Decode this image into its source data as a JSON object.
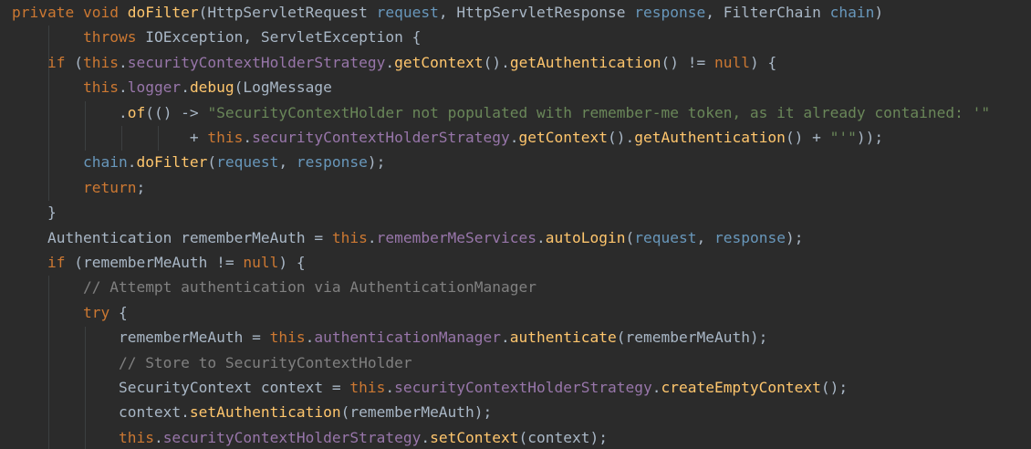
{
  "editor": {
    "language": "java",
    "colors": {
      "background": "#2b2b2b",
      "keyword": "#cc7832",
      "method": "#ffc66d",
      "field": "#9876aa",
      "parameter": "#6897bb",
      "string": "#6a8759",
      "comment": "#808080",
      "plain": "#a9b7c6"
    },
    "lines": [
      [
        {
          "t": "kw",
          "v": "private void "
        },
        {
          "t": "fn",
          "v": "doFilter"
        },
        {
          "t": "pl",
          "v": "(HttpServletRequest "
        },
        {
          "t": "prm",
          "v": "request"
        },
        {
          "t": "pl",
          "v": ", HttpServletResponse "
        },
        {
          "t": "prm",
          "v": "response"
        },
        {
          "t": "pl",
          "v": ", FilterChain "
        },
        {
          "t": "prm",
          "v": "chain"
        },
        {
          "t": "pl",
          "v": ")"
        }
      ],
      [
        {
          "t": "pl",
          "v": "        "
        },
        {
          "t": "kw",
          "v": "throws "
        },
        {
          "t": "pl",
          "v": "IOException, ServletException {"
        }
      ],
      [
        {
          "t": "pl",
          "v": "    "
        },
        {
          "t": "kw",
          "v": "if "
        },
        {
          "t": "pl",
          "v": "("
        },
        {
          "t": "kw",
          "v": "this"
        },
        {
          "t": "pl",
          "v": "."
        },
        {
          "t": "fld",
          "v": "securityContextHolderStrategy"
        },
        {
          "t": "pl",
          "v": "."
        },
        {
          "t": "fn",
          "v": "getContext"
        },
        {
          "t": "pl",
          "v": "()."
        },
        {
          "t": "fn",
          "v": "getAuthentication"
        },
        {
          "t": "pl",
          "v": "() != "
        },
        {
          "t": "kw",
          "v": "null"
        },
        {
          "t": "pl",
          "v": ") {"
        }
      ],
      [
        {
          "t": "pl",
          "v": "        "
        },
        {
          "t": "kw",
          "v": "this"
        },
        {
          "t": "pl",
          "v": "."
        },
        {
          "t": "fld",
          "v": "logger"
        },
        {
          "t": "pl",
          "v": "."
        },
        {
          "t": "fn",
          "v": "debug"
        },
        {
          "t": "pl",
          "v": "(LogMessage"
        }
      ],
      [
        {
          "t": "pl",
          "v": "            ."
        },
        {
          "t": "fn",
          "v": "of"
        },
        {
          "t": "pl",
          "v": "(() -> "
        },
        {
          "t": "str",
          "v": "\"SecurityContextHolder not populated with remember-me token, as it already contained: '\""
        }
      ],
      [
        {
          "t": "pl",
          "v": "                    + "
        },
        {
          "t": "kw",
          "v": "this"
        },
        {
          "t": "pl",
          "v": "."
        },
        {
          "t": "fld",
          "v": "securityContextHolderStrategy"
        },
        {
          "t": "pl",
          "v": "."
        },
        {
          "t": "fn",
          "v": "getContext"
        },
        {
          "t": "pl",
          "v": "()."
        },
        {
          "t": "fn",
          "v": "getAuthentication"
        },
        {
          "t": "pl",
          "v": "() + "
        },
        {
          "t": "str",
          "v": "\"'\""
        },
        {
          "t": "pl",
          "v": "));"
        }
      ],
      [
        {
          "t": "pl",
          "v": "        "
        },
        {
          "t": "prm",
          "v": "chain"
        },
        {
          "t": "pl",
          "v": "."
        },
        {
          "t": "fn",
          "v": "doFilter"
        },
        {
          "t": "pl",
          "v": "("
        },
        {
          "t": "prm",
          "v": "request"
        },
        {
          "t": "pl",
          "v": ", "
        },
        {
          "t": "prm",
          "v": "response"
        },
        {
          "t": "pl",
          "v": ");"
        }
      ],
      [
        {
          "t": "pl",
          "v": "        "
        },
        {
          "t": "kw",
          "v": "return"
        },
        {
          "t": "pl",
          "v": ";"
        }
      ],
      [
        {
          "t": "pl",
          "v": "    }"
        }
      ],
      [
        {
          "t": "pl",
          "v": "    Authentication rememberMeAuth = "
        },
        {
          "t": "kw",
          "v": "this"
        },
        {
          "t": "pl",
          "v": "."
        },
        {
          "t": "fld",
          "v": "rememberMeServices"
        },
        {
          "t": "pl",
          "v": "."
        },
        {
          "t": "fn",
          "v": "autoLogin"
        },
        {
          "t": "pl",
          "v": "("
        },
        {
          "t": "prm",
          "v": "request"
        },
        {
          "t": "pl",
          "v": ", "
        },
        {
          "t": "prm",
          "v": "response"
        },
        {
          "t": "pl",
          "v": ");"
        }
      ],
      [
        {
          "t": "pl",
          "v": "    "
        },
        {
          "t": "kw",
          "v": "if "
        },
        {
          "t": "pl",
          "v": "(rememberMeAuth != "
        },
        {
          "t": "kw",
          "v": "null"
        },
        {
          "t": "pl",
          "v": ") {"
        }
      ],
      [
        {
          "t": "pl",
          "v": "        "
        },
        {
          "t": "cmt",
          "v": "// Attempt authentication via AuthenticationManager"
        }
      ],
      [
        {
          "t": "pl",
          "v": "        "
        },
        {
          "t": "kw",
          "v": "try "
        },
        {
          "t": "pl",
          "v": "{"
        }
      ],
      [
        {
          "t": "pl",
          "v": "            rememberMeAuth = "
        },
        {
          "t": "kw",
          "v": "this"
        },
        {
          "t": "pl",
          "v": "."
        },
        {
          "t": "fld",
          "v": "authenticationManager"
        },
        {
          "t": "pl",
          "v": "."
        },
        {
          "t": "fn",
          "v": "authenticate"
        },
        {
          "t": "pl",
          "v": "(rememberMeAuth);"
        }
      ],
      [
        {
          "t": "pl",
          "v": "            "
        },
        {
          "t": "cmt",
          "v": "// Store to SecurityContextHolder"
        }
      ],
      [
        {
          "t": "pl",
          "v": "            SecurityContext context = "
        },
        {
          "t": "kw",
          "v": "this"
        },
        {
          "t": "pl",
          "v": "."
        },
        {
          "t": "fld",
          "v": "securityContextHolderStrategy"
        },
        {
          "t": "pl",
          "v": "."
        },
        {
          "t": "fn",
          "v": "createEmptyContext"
        },
        {
          "t": "pl",
          "v": "();"
        }
      ],
      [
        {
          "t": "pl",
          "v": "            context."
        },
        {
          "t": "fn",
          "v": "setAuthentication"
        },
        {
          "t": "pl",
          "v": "(rememberMeAuth);"
        }
      ],
      [
        {
          "t": "pl",
          "v": "            "
        },
        {
          "t": "kw",
          "v": "this"
        },
        {
          "t": "pl",
          "v": "."
        },
        {
          "t": "fld",
          "v": "securityContextHolderStrategy"
        },
        {
          "t": "pl",
          "v": "."
        },
        {
          "t": "fn",
          "v": "setContext"
        },
        {
          "t": "pl",
          "v": "(context);"
        }
      ]
    ]
  }
}
